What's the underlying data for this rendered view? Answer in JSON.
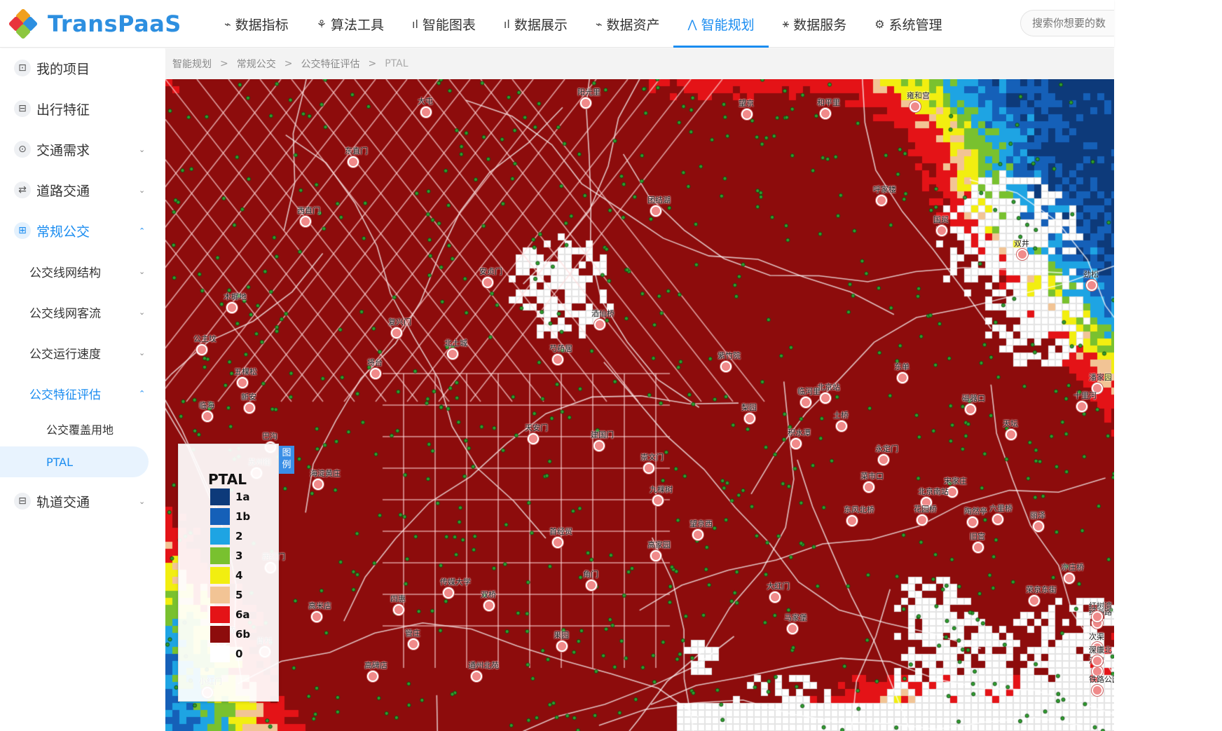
{
  "app": {
    "brand": "TransPaaS"
  },
  "nav": {
    "items": [
      {
        "label": "数据指标",
        "icon": "metrics-icon",
        "glyph": "⌁"
      },
      {
        "label": "算法工具",
        "icon": "algorithm-icon",
        "glyph": "⚘"
      },
      {
        "label": "智能图表",
        "icon": "chart-icon",
        "glyph": "ıl"
      },
      {
        "label": "数据展示",
        "icon": "display-icon",
        "glyph": "ıl"
      },
      {
        "label": "数据资产",
        "icon": "assets-icon",
        "glyph": "⌁"
      },
      {
        "label": "智能规划",
        "icon": "planning-icon",
        "glyph": "⋀",
        "active": true
      },
      {
        "label": "数据服务",
        "icon": "service-icon",
        "glyph": "⚹"
      },
      {
        "label": "系统管理",
        "icon": "settings-icon",
        "glyph": "⚙"
      }
    ],
    "search_placeholder": "搜索你想要的数"
  },
  "sidebar": {
    "items": [
      {
        "label": "我的项目",
        "icon": "project-icon",
        "glyph": "⊡"
      },
      {
        "label": "出行特征",
        "icon": "travel-icon",
        "glyph": "⊟"
      },
      {
        "label": "交通需求",
        "icon": "demand-icon",
        "glyph": "⊙",
        "chevron": "⌄"
      },
      {
        "label": "道路交通",
        "icon": "road-icon",
        "glyph": "⇄",
        "chevron": "⌄"
      },
      {
        "label": "常规公交",
        "icon": "bus-icon",
        "glyph": "⊞",
        "chevron": "⌃",
        "open": true
      }
    ],
    "sub_items": [
      {
        "label": "公交线网结构",
        "chevron": "⌄"
      },
      {
        "label": "公交线网客流",
        "chevron": "⌄"
      },
      {
        "label": "公交运行速度",
        "chevron": "⌄"
      },
      {
        "label": "公交特征评估",
        "chevron": "⌃",
        "open": true
      }
    ],
    "leaf_items": [
      {
        "label": "公交覆盖用地"
      },
      {
        "label": "PTAL",
        "selected": true
      }
    ],
    "rail": {
      "label": "轨道交通",
      "icon": "rail-icon",
      "glyph": "⊟",
      "chevron": "⌄"
    }
  },
  "breadcrumb": [
    "智能规划",
    "常规公交",
    "公交特征评估",
    "PTAL"
  ],
  "breadcrumb_sep": ">",
  "map": {
    "stations": [
      "阳光里",
      "大屯",
      "望京",
      "和平里",
      "雍和宫",
      "东直门",
      "团结湖",
      "呼家楼",
      "国贸",
      "双井",
      "劲松",
      "潘家园",
      "十里河",
      "西直门",
      "复兴门",
      "木樨地",
      "公主坟",
      "五棵松",
      "新安",
      "临海",
      "巴沟",
      "苏州街",
      "海淀黄庄",
      "天安门",
      "建国门",
      "崇文门",
      "北京站",
      "东单",
      "磁器口",
      "天坛",
      "永定门",
      "宋家庄",
      "陶然亭",
      "菜市口",
      "北京南站",
      "西红门",
      "高米店",
      "四惠",
      "高碑店",
      "传媒大学",
      "双桥",
      "管庄",
      "通州北苑",
      "果园",
      "九棵树",
      "梨园",
      "临河里",
      "土桥",
      "花园桥",
      "六里桥",
      "丽泽",
      "首经贸",
      "角门",
      "大红门",
      "马家堡",
      "成寿寺",
      "肖村",
      "小红门",
      "旧宫",
      "亦庄桥",
      "荣京东街",
      "经海路",
      "次渠",
      "红树湾",
      "深湾",
      "侨城北",
      "深康",
      "铁路公园",
      "紫竹院",
      "积水潭",
      "安贞门",
      "北土城",
      "芍药居",
      "酒仙桥",
      "将台",
      "东风北桥",
      "高家园",
      "望京西"
    ]
  },
  "legend": {
    "title": "PTAL",
    "tab": "图例",
    "levels": [
      {
        "label": "1a",
        "color": "#0d3a7a"
      },
      {
        "label": "1b",
        "color": "#1560b8"
      },
      {
        "label": "2",
        "color": "#1ea4e3"
      },
      {
        "label": "3",
        "color": "#79c12f"
      },
      {
        "label": "4",
        "color": "#f2ee10"
      },
      {
        "label": "5",
        "color": "#f2c495"
      },
      {
        "label": "6a",
        "color": "#e41317"
      },
      {
        "label": "6b",
        "color": "#8d0c0c"
      },
      {
        "label": "0",
        "color": "#ffffff"
      }
    ]
  }
}
